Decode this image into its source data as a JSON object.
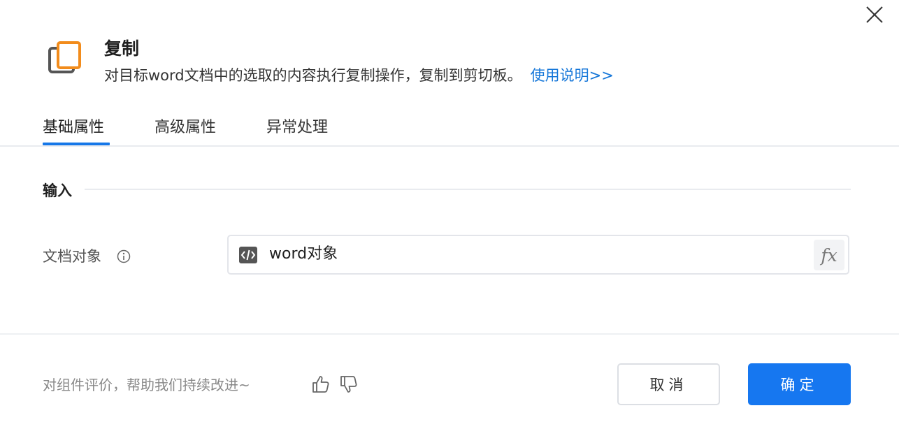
{
  "header": {
    "title": "复制",
    "description": "对目标word文档中的选取的内容执行复制操作，复制到剪切板。",
    "help_link": "使用说明>>",
    "icon": "copy-icon",
    "accent_color": "#f28c1c"
  },
  "tabs": [
    {
      "label": "基础属性",
      "active": true
    },
    {
      "label": "高级属性",
      "active": false
    },
    {
      "label": "异常处理",
      "active": false
    }
  ],
  "section": {
    "title": "输入"
  },
  "fields": [
    {
      "label": "文档对象",
      "value": "word对象",
      "value_icon": "code-icon",
      "action_label": "fx"
    }
  ],
  "footer": {
    "feedback_text": "对组件评价，帮助我们持续改进~",
    "cancel_label": "取消",
    "confirm_label": "确定",
    "primary_color": "#1677f0"
  }
}
